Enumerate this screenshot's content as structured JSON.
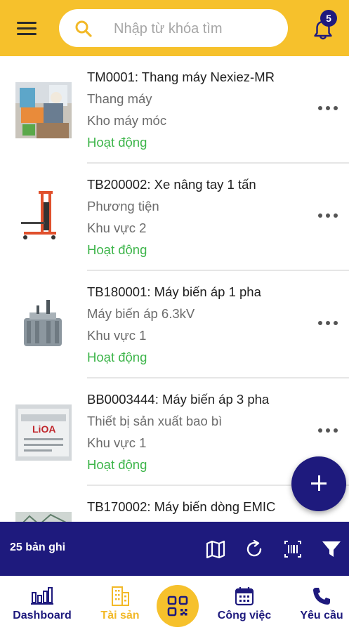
{
  "header": {
    "search_placeholder": "Nhập từ khóa tìm",
    "notification_count": "5"
  },
  "assets": [
    {
      "title": "TM0001: Thang máy Nexiez-MR",
      "category": "Thang máy",
      "location": "Kho máy móc",
      "status": "Hoạt động"
    },
    {
      "title": "TB200002: Xe nâng tay 1 tấn",
      "category": "Phương tiện",
      "location": "Khu vực 2",
      "status": "Hoạt động"
    },
    {
      "title": "TB180001: Máy biến áp 1 pha",
      "category": "Máy biến áp 6.3kV",
      "location": "Khu vực 1",
      "status": "Hoạt động"
    },
    {
      "title": "BB0003444: Máy biến áp 3 pha",
      "category": "Thiết bị sản xuất bao bì",
      "location": "Khu vực 1",
      "status": "Hoạt động"
    },
    {
      "title": "TB170002: Máy biến dòng EMIC",
      "category": "",
      "location": "",
      "status": ""
    }
  ],
  "toolbar": {
    "record_count": "25 bản ghi"
  },
  "bottom_nav": {
    "dashboard": "Dashboard",
    "assets": "Tài sản",
    "tasks": "Công việc",
    "requests": "Yêu cầu"
  },
  "colors": {
    "primary": "#1e1a7d",
    "accent": "#f6c12c",
    "status_active": "#3db54a"
  },
  "thumb_text": {
    "lioa_brand": "LiOA"
  }
}
